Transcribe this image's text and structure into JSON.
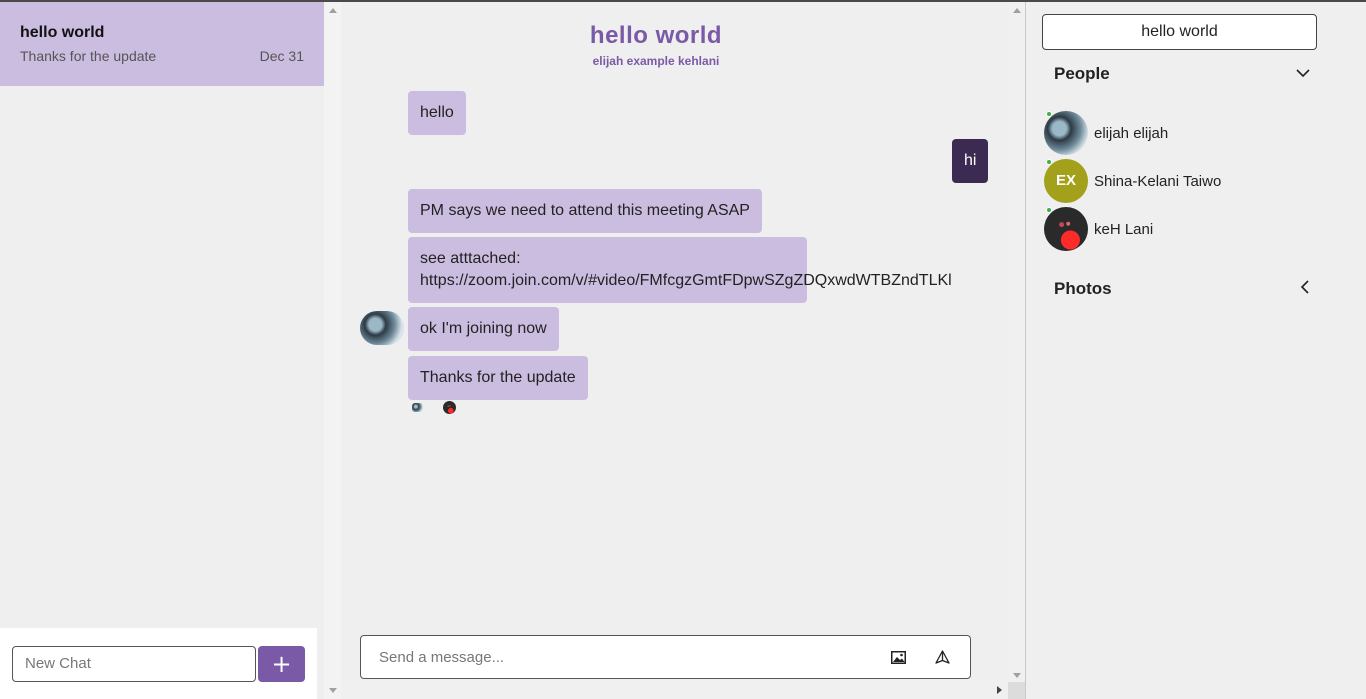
{
  "sidebar": {
    "chats": [
      {
        "title": "hello world",
        "preview": "Thanks for the update",
        "date": "Dec 31"
      }
    ],
    "new_chat_placeholder": "New Chat",
    "add_button_label": "+"
  },
  "conversation": {
    "title": "hello world",
    "participants": "elijah example kehlani",
    "messages": [
      {
        "text": "hello",
        "mine": false
      },
      {
        "text": "hi",
        "mine": true
      },
      {
        "text": "PM says we need to attend this meeting ASAP",
        "mine": false
      },
      {
        "text_line1": "see atttached:",
        "text_line2": "https://zoom.join.com/v/#video/FMfcgzGmtFDpwSZgZDQxwdWTBZndTLKl",
        "mine": false
      },
      {
        "text": "ok I'm joining now",
        "mine": false
      },
      {
        "text": "Thanks for the update",
        "mine": false
      }
    ],
    "compose_placeholder": "Send a message..."
  },
  "details": {
    "chat_title": "hello world",
    "people_label": "People",
    "people": [
      {
        "name": "elijah elijah",
        "online": true,
        "avatar": "photo"
      },
      {
        "name": "Shina-Kelani Taiwo",
        "online": true,
        "avatar": "initials",
        "initials": "EX",
        "color": "#a3a11c"
      },
      {
        "name": "keH Lani",
        "online": true,
        "avatar": "photo-dark"
      }
    ],
    "photos_label": "Photos"
  },
  "colors": {
    "accent": "#7a5aa6",
    "bubble": "#cbbde0",
    "bubble_mine": "#3b2a52",
    "online": "#3cb043"
  },
  "icons": [
    "image-icon",
    "send-icon",
    "chevron-down-icon",
    "chevron-left-icon",
    "plus-icon"
  ]
}
